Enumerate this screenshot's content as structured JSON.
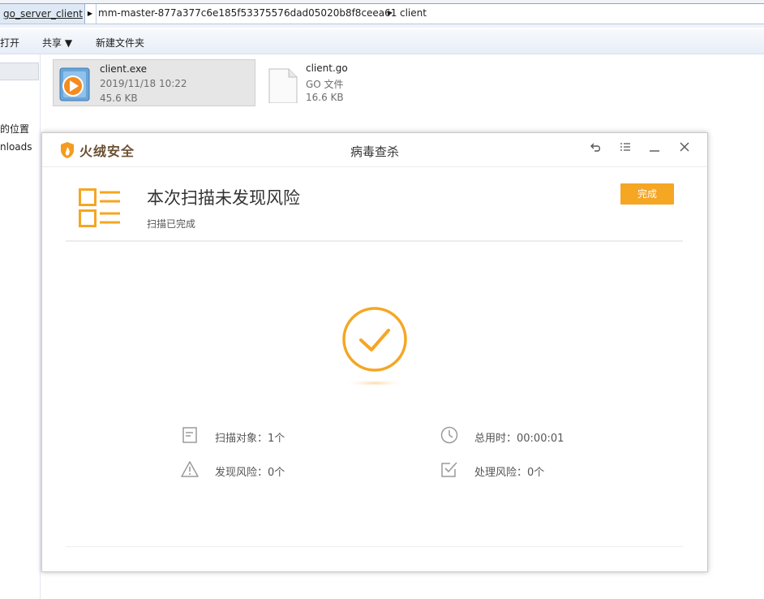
{
  "explorer": {
    "breadcrumb": [
      "go_server_client",
      "mm-master-877a377c6e185f53375576dad05020b8f8ceea61",
      "client"
    ],
    "toolbar": {
      "open_label": "打开",
      "share_label": "共享 ▼",
      "new_folder_label": "新建文件夹"
    },
    "nav": {
      "location_label": "的位置",
      "downloads_label": "nloads"
    },
    "files": [
      {
        "name": "client.exe",
        "date": "2019/11/18 10:22",
        "size": "45.6 KB",
        "icon": "media-player-exe-icon"
      },
      {
        "name": "client.go",
        "type": "GO 文件",
        "size": "16.6 KB",
        "icon": "blank-document-icon"
      }
    ]
  },
  "dialog": {
    "brand": "火绒安全",
    "title": "病毒查杀",
    "headline": "本次扫描未发现风险",
    "subtitle": "扫描已完成",
    "done_label": "完成",
    "stats": {
      "scan_objects": "扫描对象：1个",
      "total_time": "总用时：00:00:01",
      "risks_found": "发现风险：0个",
      "risks_handled": "处理风险：0个"
    }
  },
  "colors": {
    "accent": "#f5a623",
    "brand_brown": "#6b4f33"
  }
}
